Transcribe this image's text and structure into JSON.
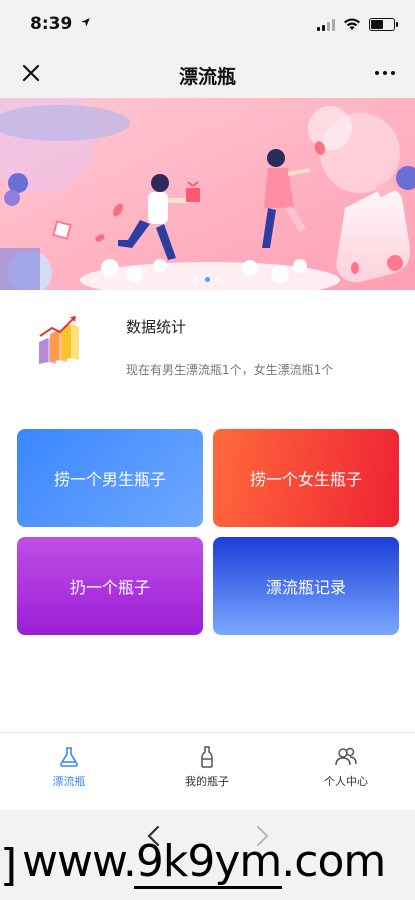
{
  "status_bar": {
    "time": "8:39"
  },
  "title_bar": {
    "title": "漂流瓶"
  },
  "banner": {
    "slide_count": 3,
    "active_slide": 1
  },
  "stats": {
    "title": "数据统计",
    "description": "现在有男生漂流瓶1个，女生漂流瓶1个"
  },
  "actions": {
    "catch_male": "捞一个男生瓶子",
    "catch_female": "捞一个女生瓶子",
    "throw_bottle": "扔一个瓶子",
    "bottle_records": "漂流瓶记录"
  },
  "tabbar": {
    "tabs": [
      {
        "label": "漂流瓶",
        "icon": "flask-icon",
        "active": true
      },
      {
        "label": "我的瓶子",
        "icon": "bottle-icon",
        "active": false
      },
      {
        "label": "个人中心",
        "icon": "user-group-icon",
        "active": false
      }
    ]
  },
  "watermark": {
    "bracket": "]",
    "text": "www.9k9ym.com"
  },
  "colors": {
    "accent": "#3a86ff",
    "male_card": "#3a86ff",
    "female_card": "#ef2233",
    "throw_card": "#a52ad9",
    "record_card": "#1c3fd8"
  }
}
